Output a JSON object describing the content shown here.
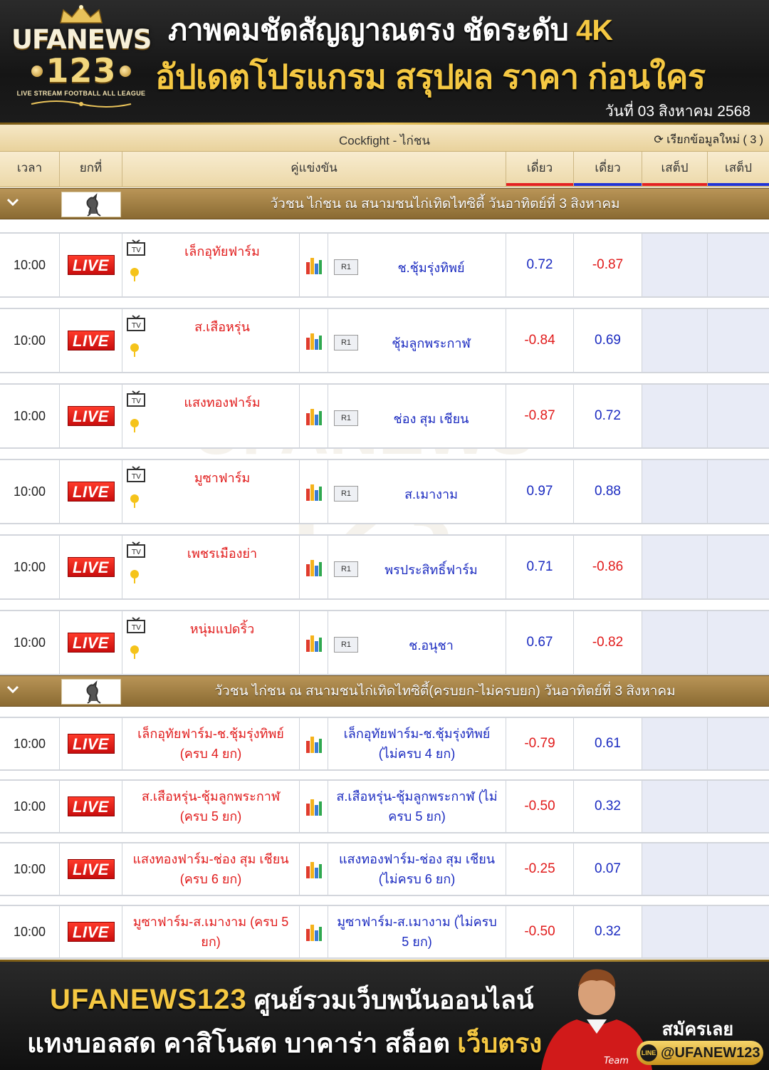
{
  "header": {
    "logo": {
      "brand": "UFANEWS",
      "number": "123",
      "tagline": "LIVE STREAM FOOTBALL ALL LEAGUE"
    },
    "headline1": "ภาพคมชัดสัญญาณตรง ชัดระดับ",
    "headline1_accent": "4K",
    "headline2": "อัปเดตโปรแกรม สรุปผล ราคา ก่อนใคร",
    "date": "วันที่ 03 สิงหาคม 2568"
  },
  "table": {
    "title": "Cockfight - ไก่ชน",
    "refresh": "เรียกข้อมูลใหม่ ( 3 )",
    "columns": {
      "time": "เวลา",
      "round": "ยกที่",
      "match": "คู่แข่งขัน",
      "single1": "เดี่ยว",
      "single2": "เดี่ยว",
      "parlay1": "เสต็ป",
      "parlay2": "เสต็ป"
    },
    "sections": [
      {
        "title": "วัวชน ไก่ชน ณ สนามชนไก่เทิดไทซิตี้ วันอาทิตย์ที่ 3 สิงหาคม",
        "rows": [
          {
            "time": "10:00",
            "live": "LIVE",
            "home": "เล็กอุทัยฟาร์ม",
            "round": "R1",
            "away": "ช.ชุ้มรุ่งทิพย์",
            "odd1": "0.72",
            "odd2": "-0.87"
          },
          {
            "time": "10:00",
            "live": "LIVE",
            "home": "ส.เสือหรุ่น",
            "round": "R1",
            "away": "ชุ้มลูกพระกาฬ",
            "odd1": "-0.84",
            "odd2": "0.69"
          },
          {
            "time": "10:00",
            "live": "LIVE",
            "home": "แสงทองฟาร์ม",
            "round": "R1",
            "away": "ช่อง สุม เชียน",
            "odd1": "-0.87",
            "odd2": "0.72"
          },
          {
            "time": "10:00",
            "live": "LIVE",
            "home": "มูซาฟาร์ม",
            "round": "R1",
            "away": "ส.เมางาม",
            "odd1": "0.97",
            "odd2": "0.88"
          },
          {
            "time": "10:00",
            "live": "LIVE",
            "home": "เพชรเมืองย่า",
            "round": "R1",
            "away": "พรประสิทธิ์ฟาร์ม",
            "odd1": "0.71",
            "odd2": "-0.86"
          },
          {
            "time": "10:00",
            "live": "LIVE",
            "home": "หนุ่มแปดริ้ว",
            "round": "R1",
            "away": "ช.อนุชา",
            "odd1": "0.67",
            "odd2": "-0.82"
          }
        ]
      },
      {
        "title": "วัวชน ไก่ชน ณ สนามชนไก่เทิดไทซิตี้(ครบยก-ไม่ครบยก) วันอาทิตย์ที่ 3 สิงหาคม",
        "rows": [
          {
            "time": "10:00",
            "live": "LIVE",
            "home": "เล็กอุทัยฟาร์ม-ช.ชุ้มรุ่งทิพย์ (ครบ 4 ยก)",
            "away": "เล็กอุทัยฟาร์ม-ช.ชุ้มรุ่งทิพย์ (ไม่ครบ 4 ยก)",
            "odd1": "-0.79",
            "odd2": "0.61"
          },
          {
            "time": "10:00",
            "live": "LIVE",
            "home": "ส.เสือหรุ่น-ชุ้มลูกพระกาฬ (ครบ 5 ยก)",
            "away": "ส.เสือหรุ่น-ชุ้มลูกพระกาฬ (ไม่ครบ 5 ยก)",
            "odd1": "-0.50",
            "odd2": "0.32"
          },
          {
            "time": "10:00",
            "live": "LIVE",
            "home": "แสงทองฟาร์ม-ช่อง สุม เชียน (ครบ 6 ยก)",
            "away": "แสงทองฟาร์ม-ช่อง สุม เชียน (ไม่ครบ 6 ยก)",
            "odd1": "-0.25",
            "odd2": "0.07"
          },
          {
            "time": "10:00",
            "live": "LIVE",
            "home": "มูซาฟาร์ม-ส.เมางาม (ครบ 5 ยก)",
            "away": "มูซาฟาร์ม-ส.เมางาม (ไม่ครบ 5 ยก)",
            "odd1": "-0.50",
            "odd2": "0.32"
          }
        ]
      }
    ]
  },
  "footer": {
    "brand": "UFANEWS123",
    "tagline1": "ศูนย์รวมเว็บพนันออนไลน์",
    "tagline2": "แทงบอลสด คาสิโนสด บาคาร่า สล็อต",
    "tagline2_accent": "เว็บตรง",
    "signup": "สมัครเลย",
    "line_id": "@UFANEW123",
    "line_icon_text": "LINE"
  },
  "colors": {
    "gold": "#f5c842",
    "negative": "#e11b1b",
    "positive": "#1a2ac0",
    "live_badge": "#e11b1b",
    "section_bar": "#a07d40"
  }
}
